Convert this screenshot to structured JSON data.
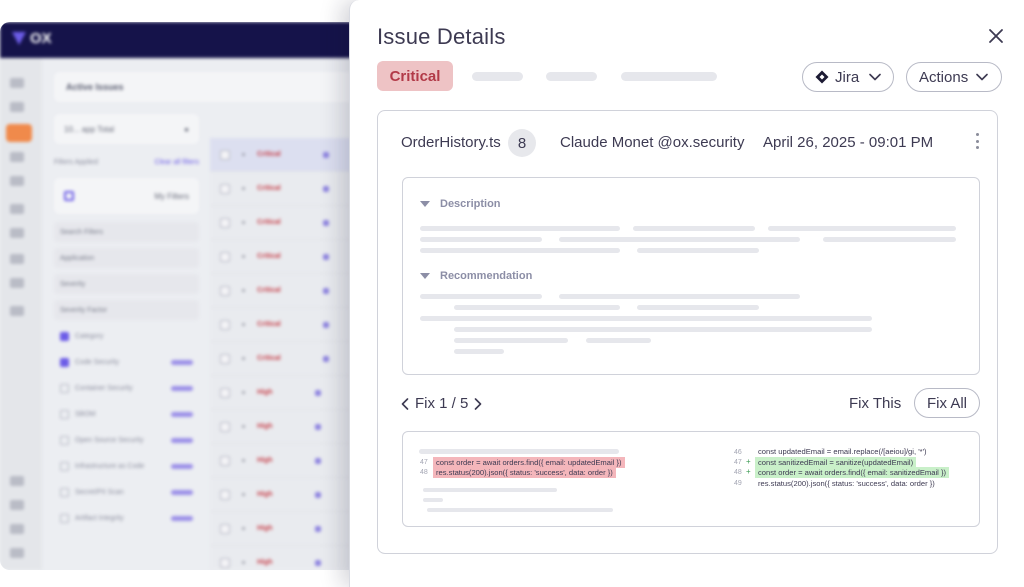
{
  "background_app": {
    "logo_text": "OX",
    "header_title": "Active Issues",
    "filter": {
      "total_label": "10... app Total",
      "filters_applied": "Filters Applied",
      "clear_all": "Clear all filters",
      "my_filters": "My Filters",
      "search_placeholder": "Search Filters",
      "dropdowns": [
        "Application",
        "Severity",
        "Severity Factor"
      ],
      "category_label": "Category",
      "categories": [
        "Code Security",
        "Container Security",
        "SBOM",
        "Open Source Security",
        "Infrastructure as Code",
        "Secret/PII Scan",
        "Artifact Integrity"
      ]
    },
    "severities": [
      "Critical",
      "Critical",
      "Critical",
      "Critical",
      "Critical",
      "Critical",
      "Critical",
      "High",
      "High",
      "High",
      "High",
      "High",
      "High"
    ]
  },
  "modal": {
    "title": "Issue Details",
    "severity_badge": "Critical",
    "jira_label": "Jira",
    "actions_label": "Actions",
    "colors": {
      "critical_bg": "#eec3c5",
      "critical_text": "#b23a48",
      "accent": "#6c5ce7"
    },
    "issue": {
      "file_name": "OrderHistory.ts",
      "comment_count": "8",
      "author": "Claude Monet @ox.security",
      "timestamp": "April 26, 2025 - 09:01 PM"
    },
    "sections": {
      "description": "Description",
      "recommendation": "Recommendation"
    },
    "fix_nav": {
      "label": "Fix 1 / 5",
      "fix_this": "Fix This",
      "fix_all": "Fix All"
    },
    "diff": {
      "left": [
        {
          "line": "47",
          "code": "const order = await orders.find({ email: updatedEmail })"
        },
        {
          "line": "48",
          "code": "res.status(200).json({ status: 'success', data: order })"
        }
      ],
      "right": [
        {
          "line": "46",
          "marker": "",
          "code": "const updatedEmail = email.replace(/[aeiou]/gi, '*')"
        },
        {
          "line": "47",
          "marker": "+",
          "code": "const sanitizedEmail = sanitize(updatedEmail)"
        },
        {
          "line": "48",
          "marker": "+",
          "code": "const order = await orders.find({ email: sanitizedEmail })"
        },
        {
          "line": "49",
          "marker": "",
          "code": "res.status(200).json({ status: 'success', data: order })"
        }
      ]
    }
  }
}
